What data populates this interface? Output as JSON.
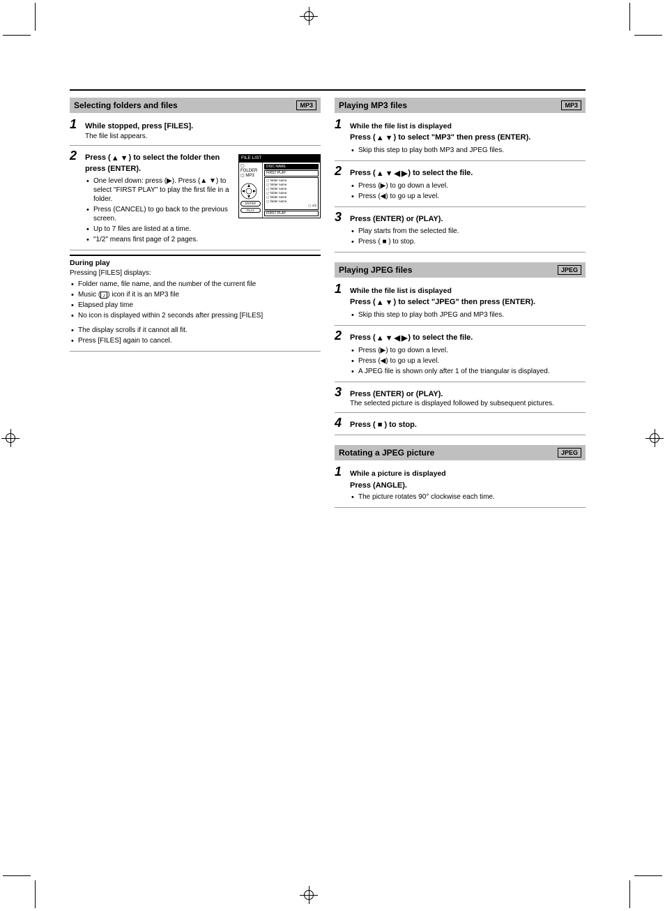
{
  "badge_mp3": "MP3",
  "badge_jpeg": "JPEG",
  "sectionA": {
    "title": "Selecting folders and files",
    "step1": {
      "lead": "While stopped, press [FILES].",
      "line2": "The file list appears."
    },
    "step2": {
      "lead_pre": "Press (",
      "lead_post": ") to select the folder then press (ENTER).",
      "bullets_a": [
        "One level down: press (▶). Press (▲ ▼) to select \"FIRST PLAY\" to play the first file in a folder.",
        "Press (CANCEL) to go back to the previous screen.",
        "Up to 7 files are listed at a time.",
        "\"1/2\" means first page of 2 pages."
      ],
      "during_title": "During play",
      "during_intro": "Pressing [FILES] displays:",
      "bullets_b": [
        "Folder name, file name, and the number of the current file",
        "Music (♪) icon if it is an MP3 file",
        "Elapsed play time",
        "No icon is displayed within 2 seconds after pressing [FILES]"
      ],
      "bullets_c": [
        "The display scrolls if it cannot all fit.",
        "Press [FILES] again to cancel."
      ]
    },
    "figure": {
      "title": "FILE LIST",
      "left_rows": [
        "FOLDER",
        "MP3"
      ],
      "btn1": "ENTER",
      "btn2": "PLAY",
      "disc_name": "DISC NAME",
      "first_play": "FIRST PLAY",
      "folders": [
        "folder name",
        "folder name",
        "folder name",
        "folder name",
        "folder name",
        "folder name"
      ],
      "pager": "1/2",
      "bottom": "FIRST PLAY"
    }
  },
  "sectionB": {
    "title": "Playing MP3 files",
    "step1": {
      "lead": "While the file list is displayed",
      "line2_pre": "Press (",
      "line2_post": ") to select \"MP3\" then press (ENTER).",
      "bullet": "Skip this step to play both MP3 and JPEG files."
    },
    "step2": {
      "lead_pre": "Press (",
      "lead_post": ") to select the file.",
      "bullets": [
        "Press (▶) to go down a level.",
        "Press (◀) to go up a level."
      ]
    },
    "step3": {
      "lead": "Press (ENTER) or (PLAY).",
      "bullets": [
        "Play starts from the selected file.",
        "Press ( ■ ) to stop."
      ]
    }
  },
  "sectionC": {
    "title": "Playing JPEG files",
    "step1": {
      "lead": "While the file list is displayed",
      "line2_pre": "Press (",
      "line2_post": ") to select \"JPEG\" then press (ENTER).",
      "bullet": "Skip this step to play both JPEG and MP3 files."
    },
    "step2": {
      "lead_pre": "Press (",
      "lead_post": ") to select the file.",
      "bullets": [
        "Press (▶) to go down a level.",
        "Press (◀) to go up a level.",
        "A JPEG file is shown only after 1 of the triangular is displayed."
      ]
    },
    "step3": {
      "lead": "Press (ENTER) or (PLAY).",
      "note": "The selected picture is displayed followed by subsequent pictures."
    },
    "step4": {
      "lead": "Press ( ■ ) to stop."
    }
  },
  "sectionD": {
    "title": "Rotating a JPEG picture",
    "step1": {
      "lead": "While a picture is displayed",
      "line2": "Press (ANGLE).",
      "bullet": "The picture rotates 90° clockwise each time."
    }
  }
}
